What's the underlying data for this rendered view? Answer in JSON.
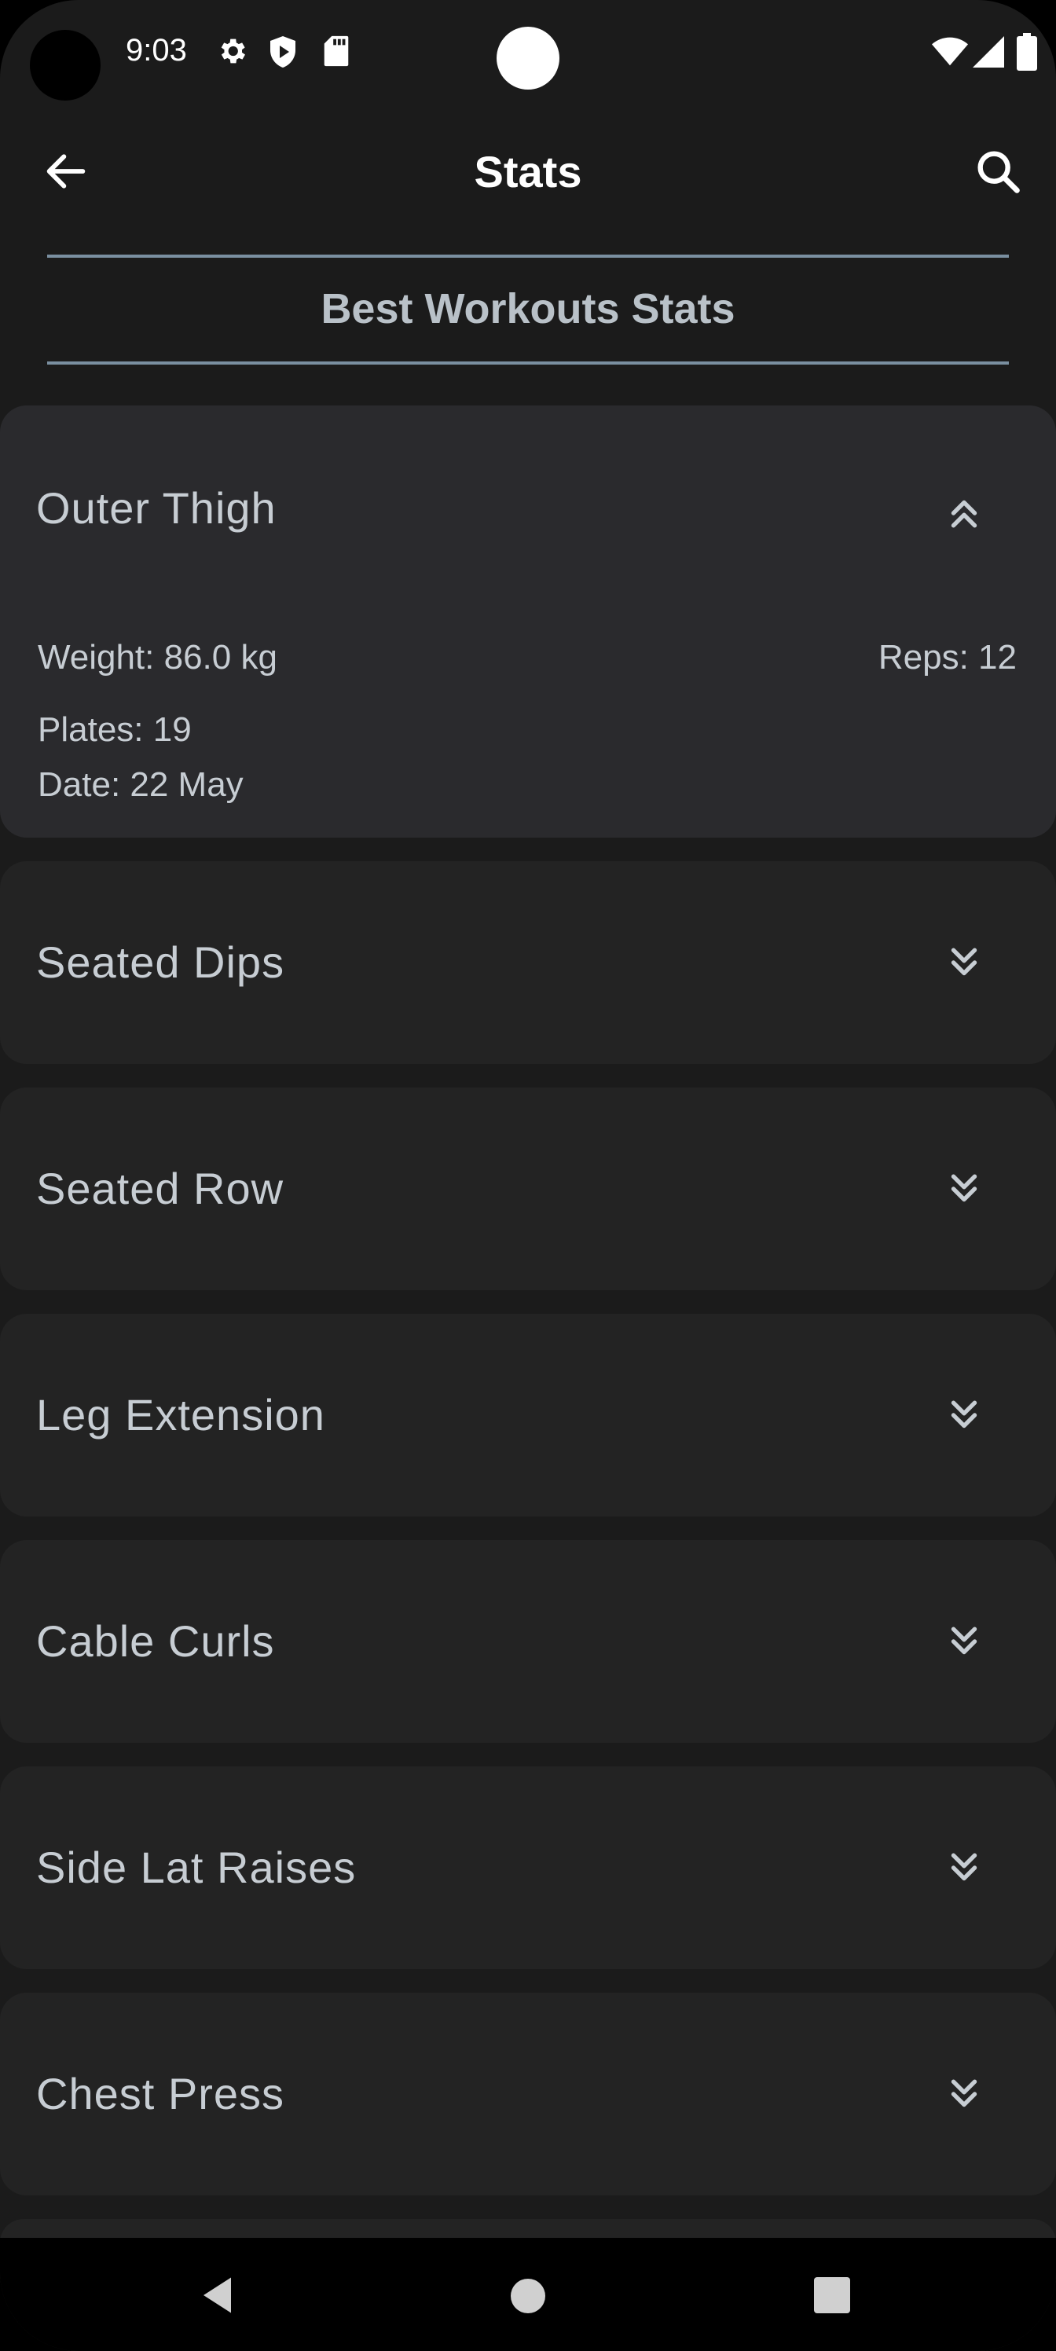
{
  "status_bar": {
    "time": "9:03",
    "icons": [
      "gear-icon",
      "shield-play-icon",
      "sd-card-icon",
      "wifi-icon",
      "signal-icon",
      "battery-icon"
    ]
  },
  "app_bar": {
    "title": "Stats",
    "back_icon": "arrow-left-icon",
    "search_icon": "search-icon"
  },
  "section": {
    "title": "Best Workouts Stats"
  },
  "workouts": [
    {
      "name": "Outer Thigh",
      "expanded": true,
      "weight": "Weight: 86.0 kg",
      "reps": "Reps: 12",
      "plates": "Plates: 19",
      "date": "Date: 22 May"
    },
    {
      "name": "Seated Dips",
      "expanded": false
    },
    {
      "name": "Seated Row",
      "expanded": false
    },
    {
      "name": "Leg Extension",
      "expanded": false
    },
    {
      "name": "Cable Curls",
      "expanded": false
    },
    {
      "name": "Side Lat Raises",
      "expanded": false
    },
    {
      "name": "Chest Press",
      "expanded": false
    }
  ],
  "colors": {
    "background": "#1b1b1b",
    "card": "#232323",
    "card_expanded": "#2a2a2d",
    "text": "#c7cdd3",
    "rule": "#7a8fa0"
  }
}
